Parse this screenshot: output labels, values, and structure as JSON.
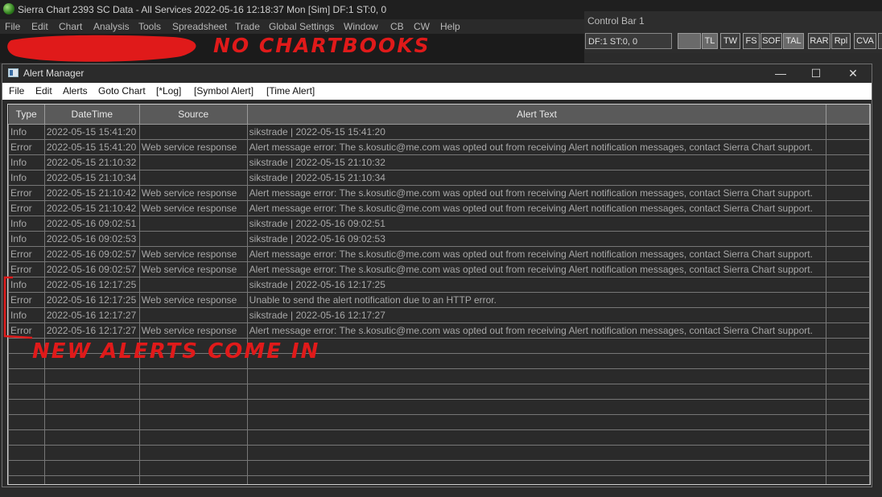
{
  "titlebar": {
    "title": "Sierra Chart 2393 SC Data - All Services 2022-05-16  12:18:37 Mon [Sim]  DF:1  ST:0, 0"
  },
  "menubar": {
    "items": [
      "File",
      "Edit",
      "Chart",
      "Analysis",
      "Tools",
      "Spreadsheet",
      "Trade",
      "Global Settings",
      "Window",
      "CB",
      "CW",
      "Help"
    ]
  },
  "control_bar": {
    "title": "Control Bar 1",
    "df_field": "DF:1  ST:0, 0",
    "buttons": [
      "",
      "TL",
      "TW",
      "FS",
      "SOF",
      "TAL",
      "RAR",
      "Rpl",
      "CVA",
      ""
    ]
  },
  "annotations": {
    "top": "NO CHARTBOOKS",
    "bottom": "NEW ALERTS COME IN",
    "color": "#e01a1a"
  },
  "alert_window": {
    "title": "Alert Manager",
    "controls": {
      "minimize": "—",
      "maximize": "☐",
      "close": "✕"
    },
    "menu": [
      "File",
      "Edit",
      "Alerts",
      "Goto Chart",
      "[*Log]",
      "[Symbol Alert]",
      "[Time Alert]"
    ],
    "columns": [
      "Type",
      "DateTime",
      "Source",
      "Alert Text",
      ""
    ],
    "rows": [
      [
        "Info",
        "2022-05-15  15:41:20",
        "",
        "sikstrade | 2022-05-15  15:41:20",
        ""
      ],
      [
        "Error",
        "2022-05-15  15:41:20",
        "Web service response",
        "Alert message error: The s.kosutic@me.com was opted out from receiving Alert notification messages, contact Sierra Chart support.",
        ""
      ],
      [
        "Info",
        "2022-05-15  21:10:32",
        "",
        "sikstrade | 2022-05-15  21:10:32",
        ""
      ],
      [
        "Info",
        "2022-05-15  21:10:34",
        "",
        "sikstrade | 2022-05-15  21:10:34",
        ""
      ],
      [
        "Error",
        "2022-05-15  21:10:42",
        "Web service response",
        "Alert message error: The s.kosutic@me.com was opted out from receiving Alert notification messages, contact Sierra Chart support.",
        ""
      ],
      [
        "Error",
        "2022-05-15  21:10:42",
        "Web service response",
        "Alert message error: The s.kosutic@me.com was opted out from receiving Alert notification messages, contact Sierra Chart support.",
        ""
      ],
      [
        "Info",
        "2022-05-16  09:02:51",
        "",
        "sikstrade | 2022-05-16  09:02:51",
        ""
      ],
      [
        "Info",
        "2022-05-16  09:02:53",
        "",
        "sikstrade | 2022-05-16  09:02:53",
        ""
      ],
      [
        "Error",
        "2022-05-16  09:02:57",
        "Web service response",
        "Alert message error: The s.kosutic@me.com was opted out from receiving Alert notification messages, contact Sierra Chart support.",
        ""
      ],
      [
        "Error",
        "2022-05-16  09:02:57",
        "Web service response",
        "Alert message error: The s.kosutic@me.com was opted out from receiving Alert notification messages, contact Sierra Chart support.",
        ""
      ],
      [
        "Info",
        "2022-05-16  12:17:25",
        "",
        "sikstrade | 2022-05-16  12:17:25",
        ""
      ],
      [
        "Error",
        "2022-05-16  12:17:25",
        "Web service response",
        "Unable to send the alert notification due to an HTTP error.",
        ""
      ],
      [
        "Info",
        "2022-05-16  12:17:27",
        "",
        "sikstrade | 2022-05-16  12:17:27",
        ""
      ],
      [
        "Error",
        "2022-05-16  12:17:27",
        "Web service response",
        "Alert message error: The s.kosutic@me.com was opted out from receiving Alert notification messages, contact Sierra Chart support.",
        ""
      ]
    ]
  }
}
